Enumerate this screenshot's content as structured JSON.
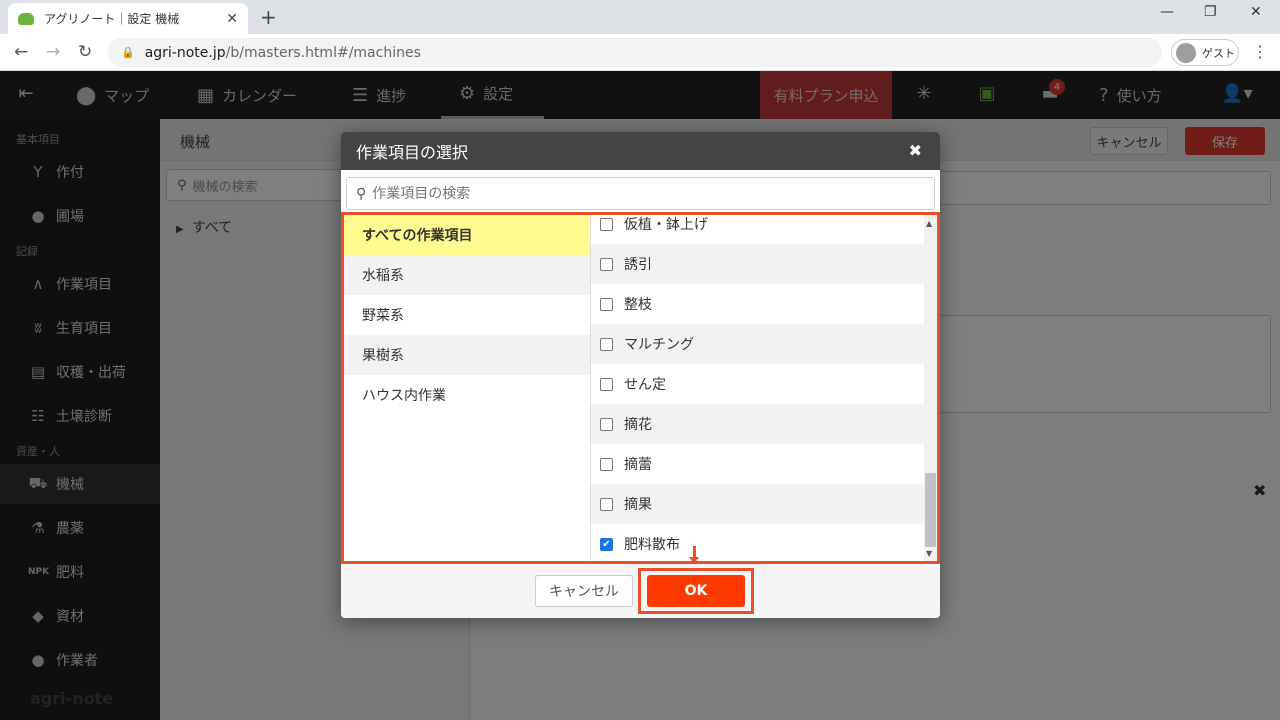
{
  "browser": {
    "tab_title": "アグリノート｜設定 機械",
    "url_domain": "agri-note.jp",
    "url_path": "/b/masters.html#/machines",
    "profile_label": "ゲスト"
  },
  "appnav": {
    "items": [
      {
        "label": "マップ",
        "icon": "map-pin-icon"
      },
      {
        "label": "カレンダー",
        "icon": "calendar-icon"
      },
      {
        "label": "進捗",
        "icon": "progress-list-icon"
      },
      {
        "label": "設定",
        "icon": "gear-icon"
      }
    ],
    "paid_plan": "有料プラン申込",
    "help": "使い方",
    "notification_count": "4"
  },
  "sidebar": {
    "sections": [
      "基本項目",
      "記録",
      "資産・人"
    ],
    "items": [
      {
        "label": "作付",
        "icon": "sprout-icon"
      },
      {
        "label": "圃場",
        "icon": "location-pin-icon"
      },
      {
        "label": "作業項目",
        "icon": "work-item-icon"
      },
      {
        "label": "生育項目",
        "icon": "grass-icon"
      },
      {
        "label": "収穫・出荷",
        "icon": "basket-icon"
      },
      {
        "label": "土壌診断",
        "icon": "sliders-icon"
      },
      {
        "label": "機械",
        "icon": "tractor-icon"
      },
      {
        "label": "農薬",
        "icon": "flask-icon"
      },
      {
        "label": "肥料",
        "icon": "npk-icon"
      },
      {
        "label": "資材",
        "icon": "material-icon"
      },
      {
        "label": "作業者",
        "icon": "person-icon"
      }
    ],
    "brand": "agri-note"
  },
  "main": {
    "title": "機械",
    "cancel_label": "キャンセル",
    "save_label": "保存",
    "search_placeholder": "機械の検索",
    "tree_root": "すべて"
  },
  "modal": {
    "title": "作業項目の選択",
    "search_placeholder": "作業項目の検索",
    "categories": [
      "すべての作業項目",
      "水稲系",
      "野菜系",
      "果樹系",
      "ハウス内作業"
    ],
    "items": [
      {
        "label": "仮植・鉢上げ",
        "checked": false
      },
      {
        "label": "誘引",
        "checked": false
      },
      {
        "label": "整枝",
        "checked": false
      },
      {
        "label": "マルチング",
        "checked": false
      },
      {
        "label": "せん定",
        "checked": false
      },
      {
        "label": "摘花",
        "checked": false
      },
      {
        "label": "摘蕾",
        "checked": false
      },
      {
        "label": "摘果",
        "checked": false
      },
      {
        "label": "肥料散布",
        "checked": true
      }
    ],
    "cancel_label": "キャンセル",
    "ok_label": "OK"
  },
  "colors": {
    "highlight": "#e8502a",
    "ok_button": "#ff3a00",
    "selected_category": "#fffb8f",
    "paid_plan": "#c23b3b"
  }
}
